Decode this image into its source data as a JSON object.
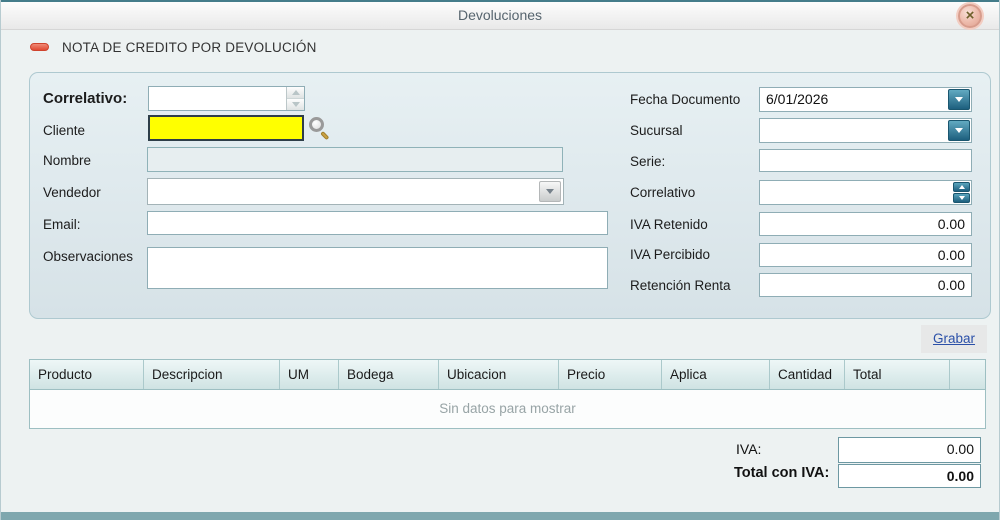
{
  "window": {
    "title": "Devoluciones"
  },
  "header": {
    "title": "NOTA DE CREDITO POR DEVOLUCIÓN"
  },
  "form": {
    "left": {
      "correlativo_label": "Correlativo:",
      "cliente_label": "Cliente",
      "nombre_label": "Nombre",
      "vendedor_label": "Vendedor",
      "email_label": "Email:",
      "observaciones_label": "Observaciones"
    },
    "right": {
      "fecha_label": "Fecha Documento",
      "fecha_value": "6/01/2026",
      "sucursal_label": "Sucursal",
      "serie_label": "Serie:",
      "correlativo_label": "Correlativo",
      "iva_retenido_label": "IVA Retenido",
      "iva_retenido_value": "0.00",
      "iva_percibido_label": "IVA Percibido",
      "iva_percibido_value": "0.00",
      "retencion_label": "Retención Renta",
      "retencion_value": "0.00"
    }
  },
  "actions": {
    "grabar_label": "Grabar"
  },
  "table": {
    "columns": [
      "Producto",
      "Descripcion",
      "UM",
      "Bodega",
      "Ubicacion",
      "Precio",
      "Aplica",
      "Cantidad",
      "Total",
      ""
    ],
    "empty_message": "Sin datos para mostrar"
  },
  "totals": {
    "iva_label": "IVA:",
    "iva_value": "0.00",
    "total_label": "Total con IVA:",
    "total_value": "0.00"
  },
  "colors": {
    "accent_teal": "#1d5f7e",
    "highlight_yellow": "#ffff00",
    "icon_red": "#e04a33"
  }
}
